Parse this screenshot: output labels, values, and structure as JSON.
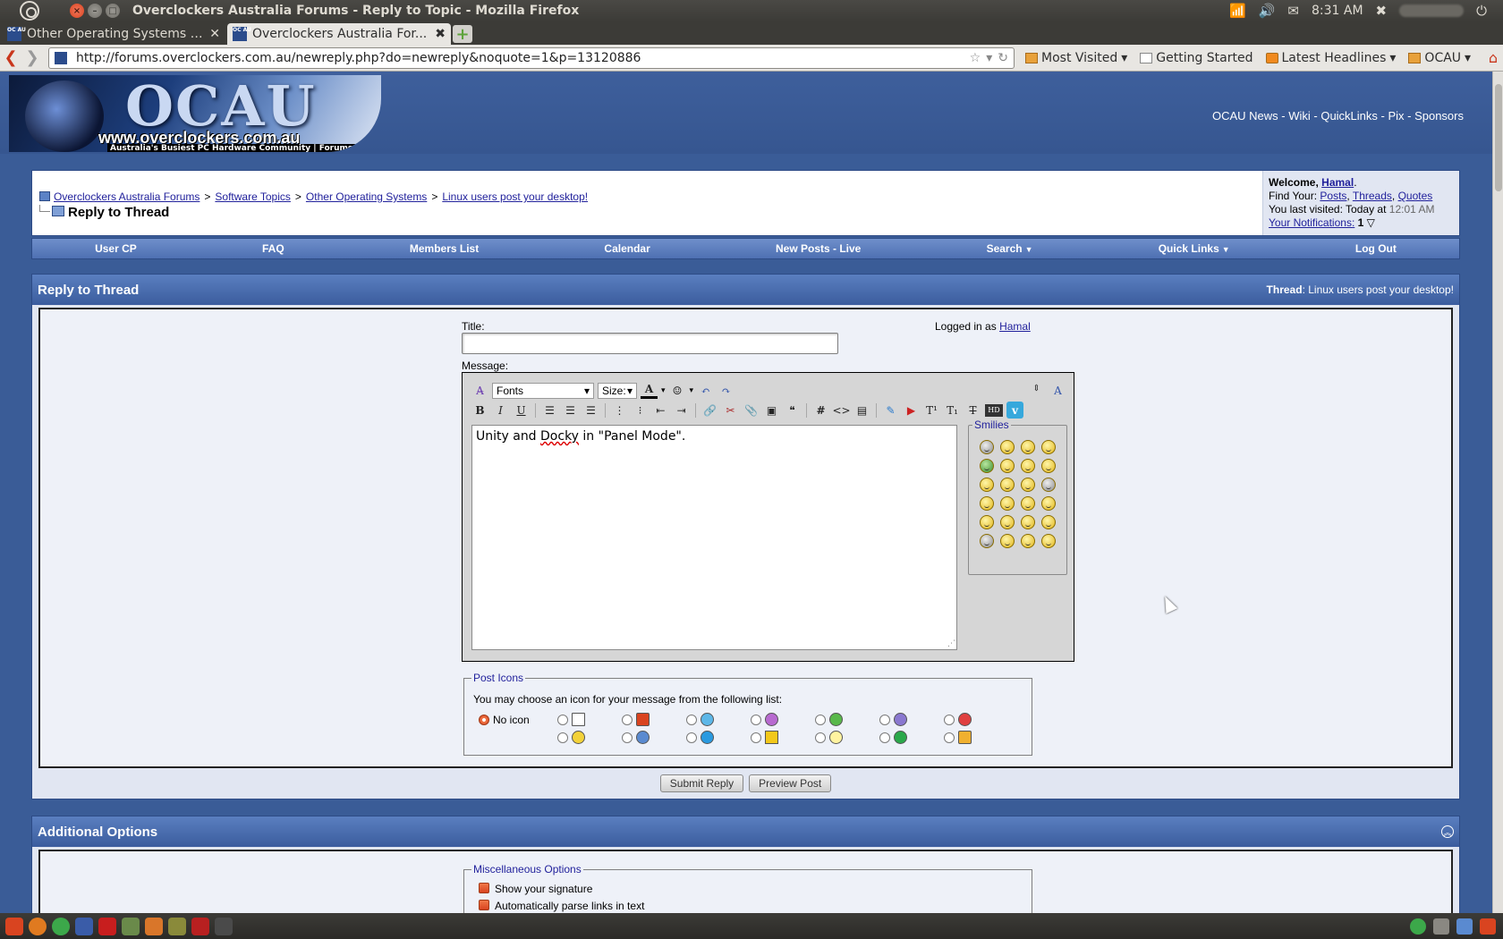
{
  "system_panel": {
    "window_title": "Overclockers Australia Forums - Reply to Topic - Mozilla Firefox",
    "clock": "8:31 AM"
  },
  "browser": {
    "tabs": [
      {
        "label": "Other Operating Systems - ...",
        "favicon": "OC AU",
        "active": false
      },
      {
        "label": "Overclockers Australia For...",
        "favicon": "OC AU",
        "active": true
      }
    ],
    "url": "http://forums.overclockers.com.au/newreply.php?do=newreply&noquote=1&p=13120886",
    "bookmarks": [
      "Most Visited",
      "Getting Started",
      "Latest Headlines",
      "OCAU"
    ]
  },
  "site": {
    "logo_text": "OCAU",
    "logo_url": "www.overclockers.com.au",
    "logo_tagline": "Australia's Busiest PC Hardware Community | Forums",
    "top_links": "OCAU News - Wiki - QuickLinks - Pix - Sponsors"
  },
  "breadcrumb": {
    "items": [
      "Overclockers Australia Forums",
      "Software Topics",
      "Other Operating Systems",
      "Linux users post your desktop!"
    ],
    "separator": ">",
    "current": "Reply to Thread"
  },
  "welcome": {
    "prefix": "Welcome,",
    "username": "Hamal",
    "find_label": "Find Your:",
    "find_links": [
      "Posts",
      "Threads",
      "Quotes"
    ],
    "last_visited_label": "You last visited: Today at",
    "last_visited_time": "12:01 AM",
    "notifications_label": "Your Notifications:",
    "notifications_count": "1"
  },
  "menu": [
    "User CP",
    "FAQ",
    "Members List",
    "Calendar",
    "New Posts - Live",
    "Search",
    "Quick Links",
    "Log Out"
  ],
  "reply_panel": {
    "title": "Reply to Thread",
    "thread_label": "Thread",
    "thread_name": ": Linux users post your desktop!",
    "title_label": "Title:",
    "title_value": "",
    "logged_in_label": "Logged in as",
    "logged_in_user": "Hamal",
    "message_label": "Message:",
    "fonts_select": "Fonts",
    "size_select": "Size:",
    "message_text_before": "Unity and ",
    "message_text_misspelled": "Docky",
    "message_text_after": " in \"Panel Mode\".",
    "smilies_legend": "Smilies",
    "post_icons_legend": "Post Icons",
    "post_icons_desc": "You may choose an icon for your message from the following list:",
    "no_icon_label": "No icon",
    "submit_label": "Submit Reply",
    "preview_label": "Preview Post"
  },
  "additional_options": {
    "title": "Additional Options",
    "misc_legend": "Miscellaneous Options",
    "options": [
      "Show your signature",
      "Automatically parse links in text"
    ]
  }
}
